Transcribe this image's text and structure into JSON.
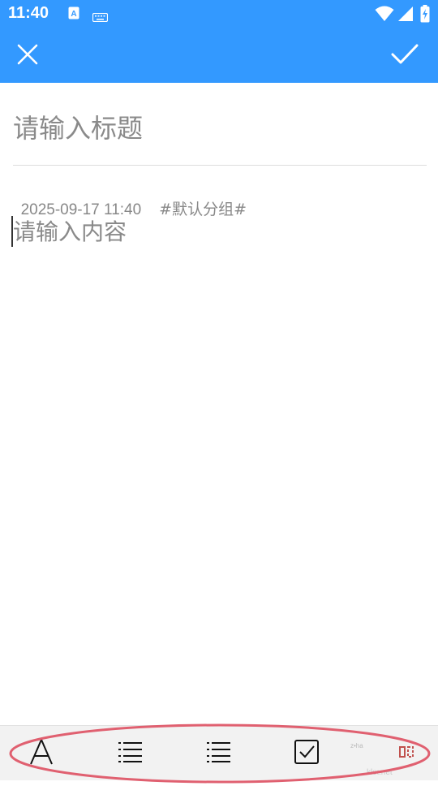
{
  "status_bar": {
    "time": "11:40",
    "left_icons": [
      "text-input-icon",
      "keyboard-icon"
    ],
    "right_icons": [
      "wifi-icon",
      "cellular-signal-icon",
      "battery-charging-icon"
    ]
  },
  "app_bar": {
    "close_icon": "close-icon",
    "confirm_icon": "checkmark-icon",
    "background_color": "#3399ff"
  },
  "editor": {
    "title_placeholder": "请输入标题",
    "date": "2025-09-17 11:40",
    "group": "#默认分组#",
    "content_placeholder": "请输入内容"
  },
  "toolbar": {
    "tools": [
      {
        "icon": "font-style-icon"
      },
      {
        "icon": "bulleted-list-icon"
      },
      {
        "icon": "numbered-list-icon"
      },
      {
        "icon": "checkbox-icon"
      },
      {
        "icon": "more-tools-icon"
      }
    ]
  },
  "watermark": "kkx.net",
  "colors": {
    "accent": "#3399ff",
    "placeholder": "#8a8a8a",
    "meta_text": "#888888",
    "toolbar_bg": "#f2f2f2",
    "highlight_ring": "#e06070"
  }
}
